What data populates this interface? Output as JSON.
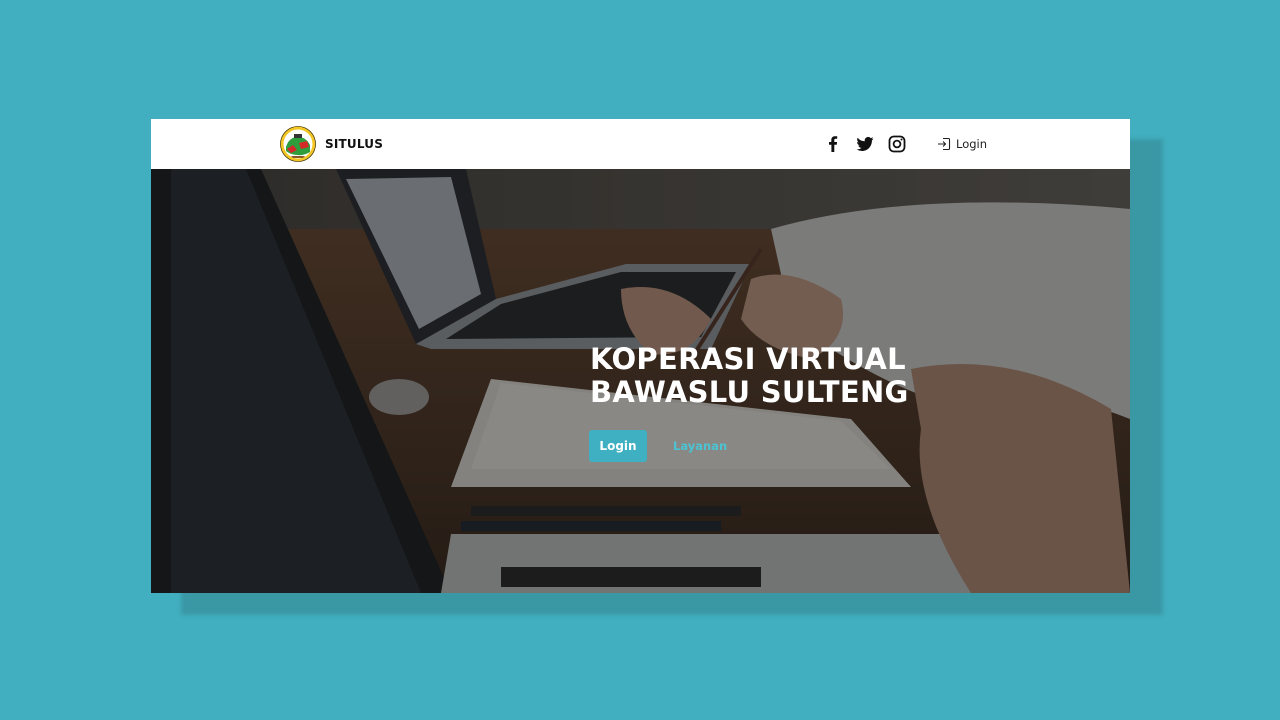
{
  "colors": {
    "background": "#41afbf",
    "accent": "#3fb0c2",
    "link": "#4cc3d3",
    "navbar": "#ffffff"
  },
  "navbar": {
    "brand_name": "SITULUS",
    "logo_icon": "bawaslu-emblem-icon",
    "social_icons": [
      "facebook-icon",
      "twitter-icon",
      "instagram-icon"
    ],
    "login_icon": "sign-in-icon",
    "login_label": "Login"
  },
  "hero": {
    "title_line1": "KOPERASI VIRTUAL",
    "title_line2": "BAWASLU SULTENG",
    "primary_button": "Login",
    "secondary_button": "Layanan"
  }
}
